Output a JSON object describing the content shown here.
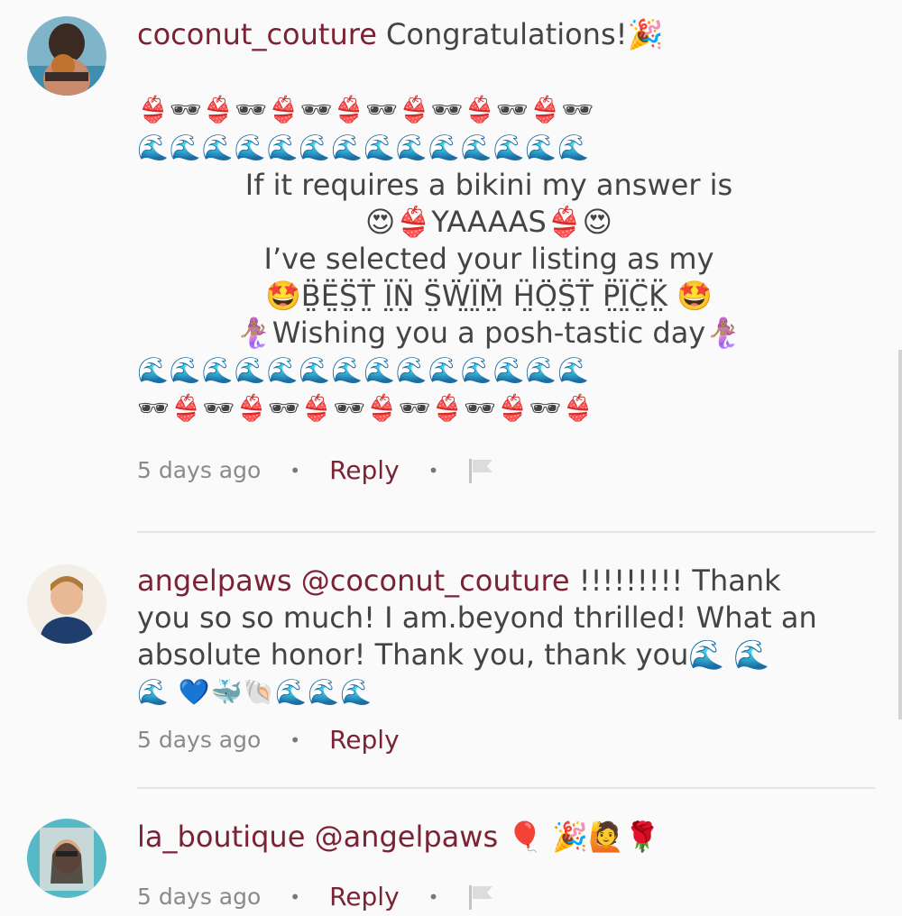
{
  "comments": [
    {
      "username": "coconut_couture",
      "first_line": "Congratulations!🎉",
      "emoji_row_1": "👙🕶👙🕶👙🕶👙🕶👙🕶👙🕶👙🕶",
      "emoji_row_2": "🌊🌊🌊🌊🌊🌊🌊🌊🌊🌊🌊🌊🌊🌊",
      "message_lines": [
        "If it requires a bikini my answer is",
        "😍👙YAAAAS👙😍",
        "I’ve selected your listing as my",
        "🤩B̤̈Ë̤S̤̈T̤̈ Ï̤N̤̈ S̤̈Ẅ̤Ï̤M̤̈ Ḧ̤Ö̤S̤̈T̤̈ P̤̈Ï̤C̤̈K̤̈ 🤩",
        "🧜🏽‍♀️Wishing you a posh-tastic day🧜🏽‍♀️"
      ],
      "emoji_row_3": "🌊🌊🌊🌊🌊🌊🌊🌊🌊🌊🌊🌊🌊🌊",
      "emoji_row_4": "🕶👙🕶👙🕶👙🕶👙🕶👙🕶👙🕶👙",
      "time": "5 days ago",
      "reply_label": "Reply",
      "separator": "•"
    },
    {
      "username": "angelpaws",
      "mention": "@coconut_couture",
      "text_lines": [
        " !!!!!!!!! Thank",
        "you so so much! I am.beyond thrilled! What an",
        "absolute honor! Thank you,  thank you🌊 🌊",
        "🌊 💙🐳🐚🌊🌊🌊"
      ],
      "time": "5 days ago",
      "reply_label": "Reply",
      "separator": "•"
    },
    {
      "username": "la_boutique",
      "mention": "@angelpaws",
      "text": " 🎈 🎉🙋🌹",
      "time": "5 days ago",
      "reply_label": "Reply",
      "separator": "•"
    }
  ],
  "icons": {
    "flag": "flag-icon"
  },
  "colors": {
    "username": "#7b2335",
    "meta_text": "#8a8a8a",
    "background": "#fafafa"
  }
}
